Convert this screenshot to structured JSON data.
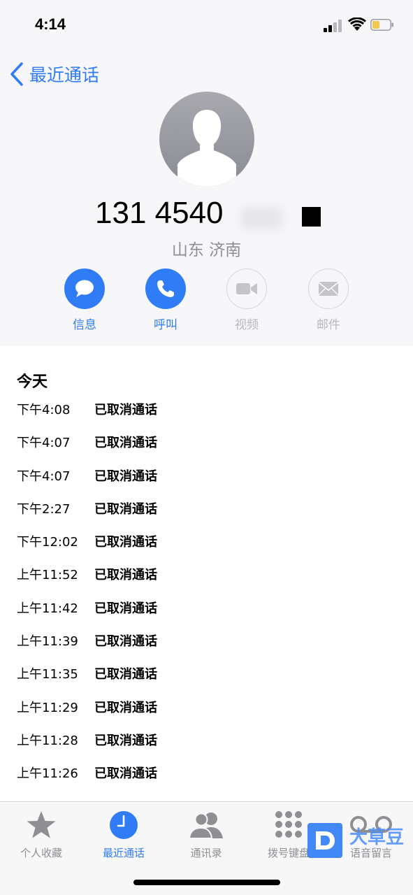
{
  "status_bar": {
    "time": "4:14"
  },
  "header": {
    "back_label": "最近通话"
  },
  "contact": {
    "number_visible": "131 4540",
    "location": "山东 济南"
  },
  "actions": [
    {
      "label": "信息",
      "icon": "message-icon",
      "enabled": true
    },
    {
      "label": "呼叫",
      "icon": "phone-icon",
      "enabled": true
    },
    {
      "label": "视频",
      "icon": "video-icon",
      "enabled": false
    },
    {
      "label": "邮件",
      "icon": "mail-icon",
      "enabled": false
    }
  ],
  "calls": {
    "day": "今天",
    "entries": [
      {
        "time": "下午4:08",
        "status": "已取消通话"
      },
      {
        "time": "下午4:07",
        "status": "已取消通话"
      },
      {
        "time": "下午4:07",
        "status": "已取消通话"
      },
      {
        "time": "下午2:27",
        "status": "已取消通话"
      },
      {
        "time": "下午12:02",
        "status": "已取消通话"
      },
      {
        "time": "上午11:52",
        "status": "已取消通话"
      },
      {
        "time": "上午11:42",
        "status": "已取消通话"
      },
      {
        "time": "上午11:39",
        "status": "已取消通话"
      },
      {
        "time": "上午11:35",
        "status": "已取消通话"
      },
      {
        "time": "上午11:29",
        "status": "已取消通话"
      },
      {
        "time": "上午11:28",
        "status": "已取消通话"
      },
      {
        "time": "上午11:26",
        "status": "已取消通话"
      }
    ]
  },
  "tab_bar": {
    "tabs": [
      {
        "label": "个人收藏",
        "icon": "star-icon",
        "active": false
      },
      {
        "label": "最近通话",
        "icon": "clock-icon",
        "active": true
      },
      {
        "label": "通讯录",
        "icon": "contacts-icon",
        "active": false
      },
      {
        "label": "拨号键盘",
        "icon": "keypad-icon",
        "active": false
      },
      {
        "label": "语音留言",
        "icon": "voicemail-icon",
        "active": false
      }
    ]
  },
  "watermark": {
    "text": "大草豆"
  },
  "colors": {
    "accent": "#2f7cf6",
    "secondary_text": "#8e8e93",
    "disabled": "#b8b8bd",
    "header_bg": "#f7f7fa"
  }
}
